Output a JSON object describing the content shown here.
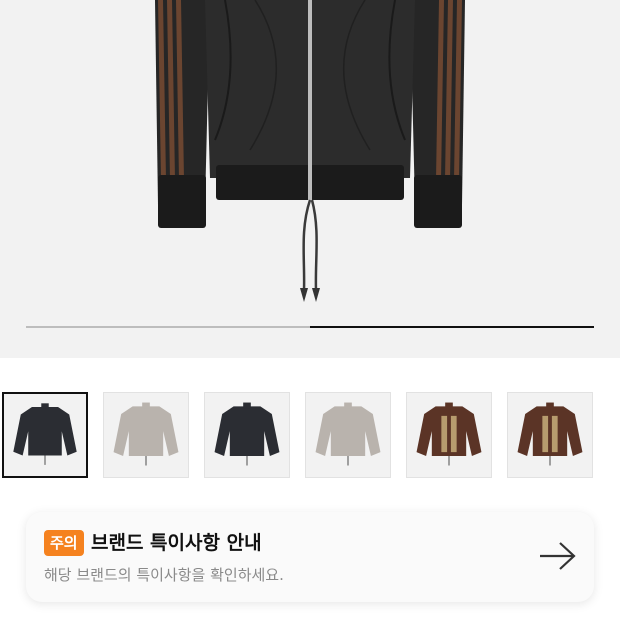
{
  "gallery": {
    "main_image": "black-track-jacket-image",
    "current_slide_fraction": 0.5,
    "selected_index": 0,
    "thumbnails": [
      {
        "name": "thumb-black-jacket-front",
        "color": "#2b2d33"
      },
      {
        "name": "thumb-grey-jacket-back",
        "color": "#b9b3ad"
      },
      {
        "name": "thumb-black-jacket-back",
        "color": "#2b2d33"
      },
      {
        "name": "thumb-grey-jacket-back-2",
        "color": "#b9b3ad"
      },
      {
        "name": "thumb-brown-jacket-front",
        "color": "#5b3426"
      },
      {
        "name": "thumb-brown-jacket-front-2",
        "color": "#5b3426"
      }
    ]
  },
  "notice": {
    "badge": "주의",
    "title": "브랜드 특이사항 안내",
    "description": "해당 브랜드의 특이사항을 확인하세요.",
    "arrow_icon": "arrow-right-icon"
  },
  "colors": {
    "badge_bg": "#f5821f",
    "hero_bg": "#f2f2f2",
    "jacket_body": "#2a2a2a",
    "stripe": "#6b4530"
  }
}
